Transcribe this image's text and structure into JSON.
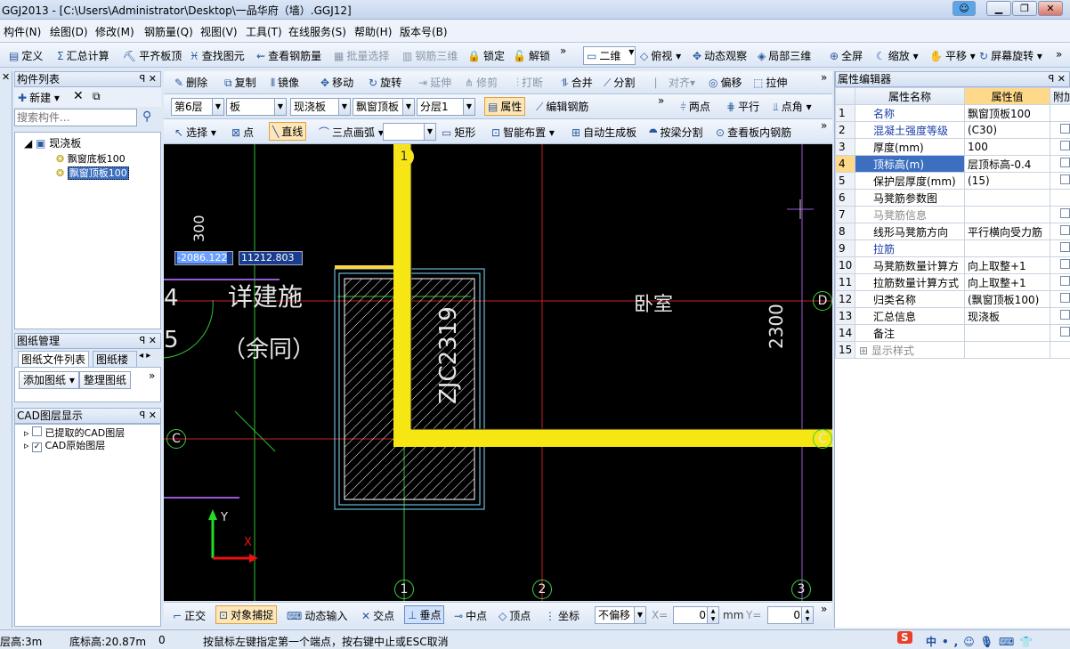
{
  "window": {
    "title": "GGJ2013 - [C:\\Users\\Administrator\\Desktop\\一品华府（墙）.GGJ12]"
  },
  "menu": [
    "构件(N)",
    "绘图(D)",
    "修改(M)",
    "钢筋量(Q)",
    "视图(V)",
    "工具(T)",
    "在线服务(S)",
    "帮助(H)",
    "版本号(B)"
  ],
  "toolbar1": {
    "define": "定义",
    "sum": "汇总计算",
    "flat": "平齐板顶",
    "find": "查找图元",
    "view_rebar": "查看钢筋量",
    "batch": "批量选择",
    "rebar3d": "钢筋三维",
    "lock": "锁定",
    "unlock": "解锁",
    "mode_2d": "二维",
    "top_view": "俯视",
    "dynamic": "动态观察",
    "local3d": "局部三维",
    "fullscreen": "全屏",
    "zoom": "缩放",
    "pan": "平移",
    "rotate": "屏幕旋转"
  },
  "toolbar2": {
    "delete": "删除",
    "copy": "复制",
    "mirror": "镜像",
    "move": "移动",
    "rotate": "旋转",
    "extend": "延伸",
    "trim": "修剪",
    "break": "打断",
    "merge": "合并",
    "split": "分割",
    "align": "对齐",
    "offset": "偏移",
    "stretch": "拉伸"
  },
  "toolbar3": {
    "floor": "第6层",
    "type": "板",
    "subtype": "现浇板",
    "component": "飘窗顶板",
    "layer": "分层1",
    "properties": "属性",
    "edit_rebar": "编辑钢筋",
    "two_points": "两点",
    "parallel": "平行",
    "point_angle": "点角"
  },
  "toolbar4": {
    "select": "选择",
    "point": "点",
    "line": "直线",
    "arc": "三点画弧",
    "rect": "矩形",
    "smart": "智能布置",
    "auto_gen": "自动生成板",
    "by_beam": "按梁分割",
    "view_inner": "查看板内钢筋"
  },
  "component_list": {
    "title": "构件列表",
    "new": "新建",
    "search_placeholder": "搜索构件...",
    "root": "现浇板",
    "items": [
      "飘窗底板100",
      "飘窗顶板100"
    ]
  },
  "drawing_mgmt": {
    "title": "图纸管理",
    "tab1": "图纸文件列表",
    "tab2": "图纸楼",
    "add": "添加图纸",
    "organize": "整理图纸"
  },
  "cad_layer": {
    "title": "CAD图层显示",
    "items": [
      "已提取的CAD图层",
      "CAD原始图层"
    ]
  },
  "canvas": {
    "input_x": "-2086.122",
    "input_y": "11212.803",
    "text_main": "详建施",
    "text_sub": "（余同）",
    "text_frag1": "4",
    "text_frag2": "5",
    "text_dim": "300",
    "text_zjc": "ZJC2319",
    "text_room": "卧室",
    "text_2300": "2300",
    "axes": {
      "a1": "1",
      "a2": "2",
      "a3": "3",
      "c": "C",
      "d": "D"
    },
    "axis_x": "X",
    "axis_y": "Y"
  },
  "bottom_bar": {
    "ortho": "正交",
    "snap": "对象捕捉",
    "dyn_input": "动态输入",
    "intersect": "交点",
    "perp": "垂点",
    "mid": "中点",
    "vertex": "顶点",
    "coord": "坐标",
    "no_offset": "不偏移",
    "x_label": "X=",
    "x_val": "0",
    "unit": "mm",
    "y_label": "Y=",
    "y_val": "0"
  },
  "property_editor": {
    "title": "属性编辑器",
    "col_name": "属性名称",
    "col_value": "属性值",
    "col_extra": "附加",
    "rows": [
      {
        "n": "1",
        "name": "名称",
        "value": "飘窗顶板100",
        "blue": true,
        "chk": false
      },
      {
        "n": "2",
        "name": "混凝土强度等级",
        "value": "(C30)",
        "blue": true,
        "chk": true
      },
      {
        "n": "3",
        "name": "厚度(mm)",
        "value": "100",
        "blue": false,
        "chk": true
      },
      {
        "n": "4",
        "name": "顶标高(m)",
        "value": "层顶标高-0.4",
        "blue": true,
        "chk": true,
        "selected": true
      },
      {
        "n": "5",
        "name": "保护层厚度(mm)",
        "value": "(15)",
        "blue": false,
        "chk": true
      },
      {
        "n": "6",
        "name": "马凳筋参数图",
        "value": "",
        "blue": false,
        "chk": false
      },
      {
        "n": "7",
        "name": "马凳筋信息",
        "value": "",
        "blue": false,
        "chk": true,
        "gray": true
      },
      {
        "n": "8",
        "name": "线形马凳筋方向",
        "value": "平行横向受力筋",
        "blue": false,
        "chk": true
      },
      {
        "n": "9",
        "name": "拉筋",
        "value": "",
        "blue": true,
        "chk": true
      },
      {
        "n": "10",
        "name": "马凳筋数量计算方",
        "value": "向上取整+1",
        "blue": false,
        "chk": true
      },
      {
        "n": "11",
        "name": "拉筋数量计算方式",
        "value": "向上取整+1",
        "blue": false,
        "chk": true
      },
      {
        "n": "12",
        "name": "归类名称",
        "value": "(飘窗顶板100)",
        "blue": false,
        "chk": true
      },
      {
        "n": "13",
        "name": "汇总信息",
        "value": "现浇板",
        "blue": false,
        "chk": true
      },
      {
        "n": "14",
        "name": "备注",
        "value": "",
        "blue": false,
        "chk": true
      },
      {
        "n": "15",
        "name": "显示样式",
        "value": "",
        "blue": false,
        "chk": false,
        "gray": true,
        "expand": true
      }
    ]
  },
  "status": {
    "floor_height": "层高:3m",
    "base_elev": "底标高:20.87m",
    "zero": "0",
    "hint": "按鼠标左键指定第一个端点，按右键中止或ESC取消"
  }
}
